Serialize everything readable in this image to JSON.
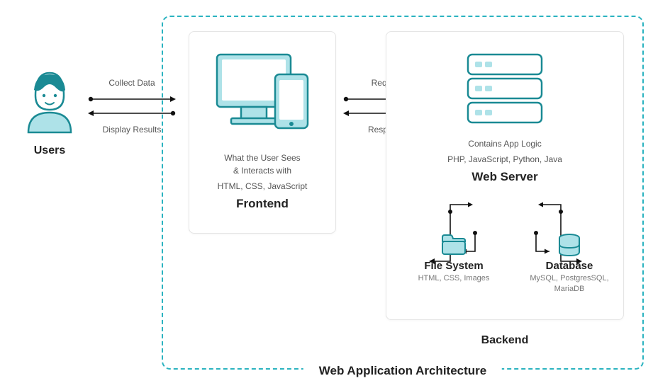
{
  "title": "Web Application Architecture",
  "users": {
    "label": "Users"
  },
  "arrows": {
    "left": {
      "top": "Collect Data",
      "bottom": "Display Results"
    },
    "right": {
      "top": "Request",
      "bottom": "Response"
    }
  },
  "frontend": {
    "line1": "What the User Sees",
    "line2": "& Interacts with",
    "tech": "HTML, CSS, JavaScript",
    "title": "Frontend"
  },
  "backend": {
    "tagline": "Contains App Logic",
    "tech": "PHP, JavaScript, Python, Java",
    "server_title": "Web Server",
    "filesystem": {
      "title": "File System",
      "tech": "HTML, CSS, Images"
    },
    "database": {
      "title": "Database",
      "tech": "MySQL, PostgresSQL, MariaDB"
    },
    "label": "Backend"
  }
}
